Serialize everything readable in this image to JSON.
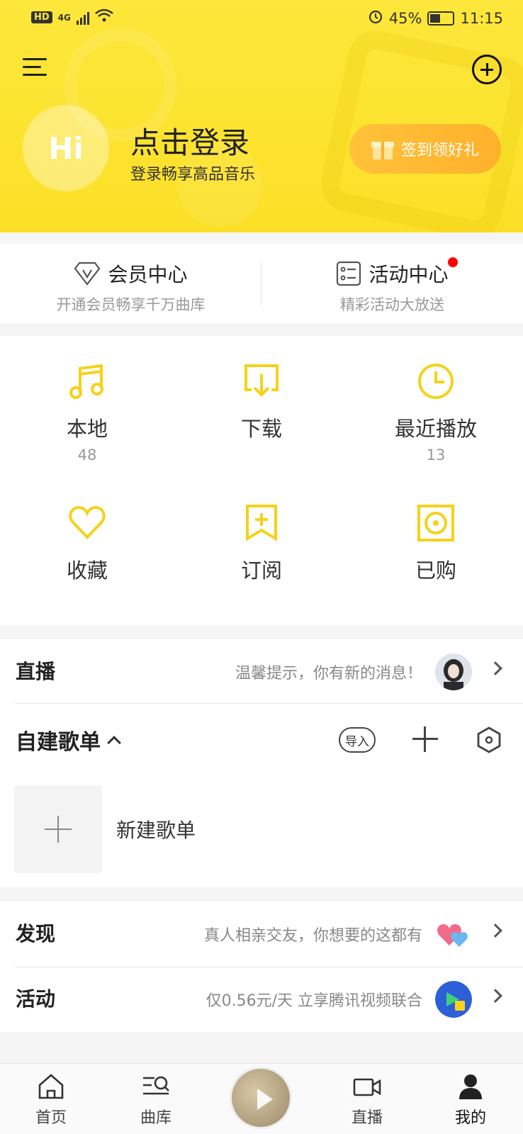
{
  "status_bar": {
    "network": "HD",
    "signal": "4G",
    "battery": "45%",
    "time": "11:15"
  },
  "header": {
    "avatar_text": "Hi",
    "login_title": "点击登录",
    "login_subtitle": "登录畅享高品音乐",
    "signin_button": "签到领好礼",
    "background_color": "#fde73a"
  },
  "member": {
    "vip": {
      "title": "会员中心",
      "subtitle": "开通会员畅享千万曲库"
    },
    "activity": {
      "title": "活动中心",
      "subtitle": "精彩活动大放送"
    }
  },
  "grid": [
    {
      "label": "本地",
      "count": "48",
      "icon": "music-note-icon"
    },
    {
      "label": "下载",
      "count": "",
      "icon": "download-icon"
    },
    {
      "label": "最近播放",
      "count": "13",
      "icon": "clock-icon"
    },
    {
      "label": "收藏",
      "count": "",
      "icon": "heart-icon"
    },
    {
      "label": "订阅",
      "count": "",
      "icon": "bookmark-plus-icon"
    },
    {
      "label": "已购",
      "count": "",
      "icon": "disc-icon"
    }
  ],
  "live": {
    "title": "直播",
    "hint": "温馨提示，你有新的消息！"
  },
  "playlist": {
    "title": "自建歌单",
    "import_label": "导入",
    "new_label": "新建歌单"
  },
  "discover": {
    "title": "发现",
    "hint": "真人相亲交友，你想要的这都有"
  },
  "activity_row": {
    "title": "活动",
    "hint": "仅0.56元/天 立享腾讯视频联合"
  },
  "bottom_nav": [
    {
      "label": "首页",
      "icon": "home-icon"
    },
    {
      "label": "曲库",
      "icon": "library-search-icon"
    },
    {
      "label": "直播",
      "icon": "video-camera-icon"
    },
    {
      "label": "我的",
      "icon": "person-icon"
    }
  ],
  "accent_color": "#f5d21a"
}
